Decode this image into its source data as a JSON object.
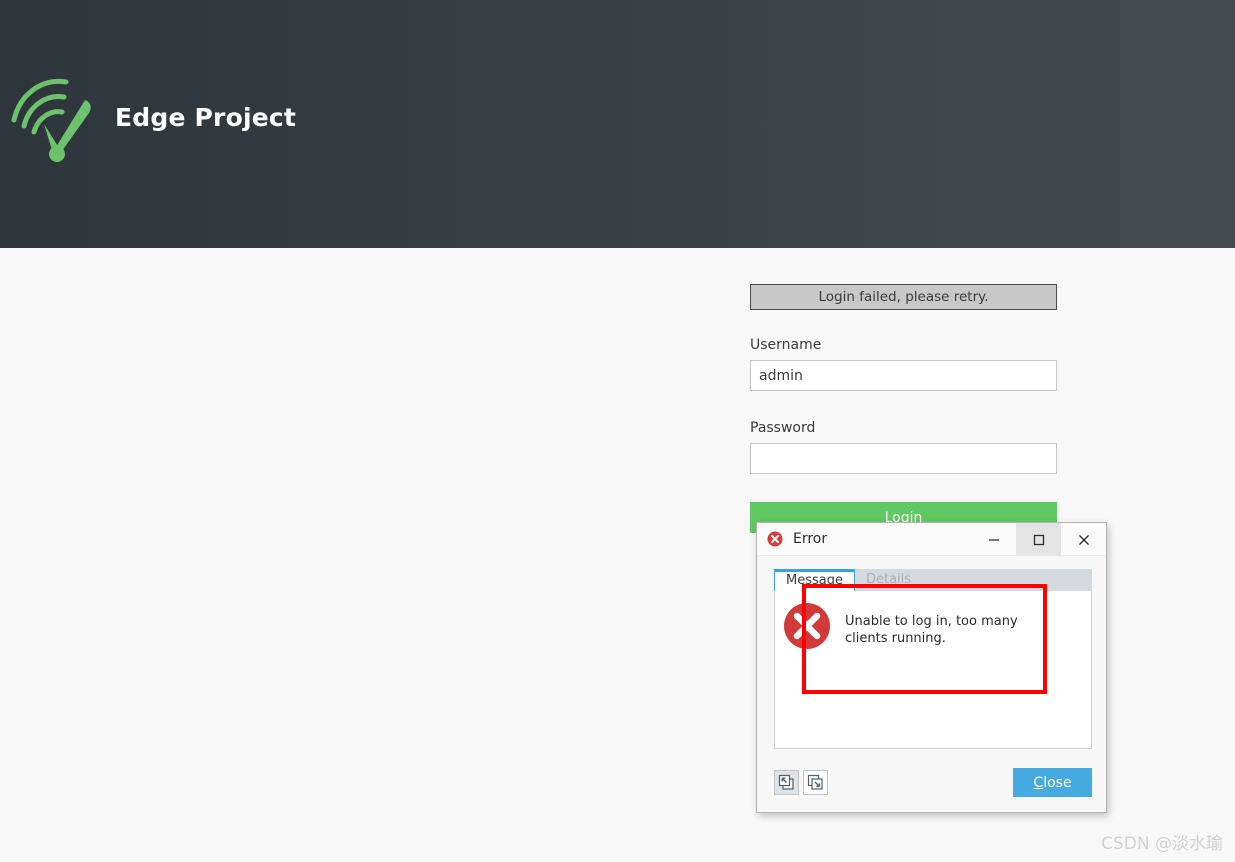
{
  "header": {
    "title": "Edge Project",
    "logo_icon": "wifi-signal-checkmark-logo",
    "logo_color": "#6dc26d",
    "background_color": "#373f45"
  },
  "login": {
    "alert": "Login failed, please retry.",
    "username_label": "Username",
    "username_value": "admin",
    "username_placeholder": "",
    "password_label": "Password",
    "password_value": "",
    "password_placeholder": "",
    "login_button": "Login",
    "login_button_color": "#61c961"
  },
  "dialog": {
    "title": "Error",
    "title_icon": "error-circle-x-icon",
    "minimize_icon": "minimize-icon",
    "maximize_icon": "maximize-icon",
    "close_icon": "close-x-icon",
    "tabs": [
      {
        "label": "Message",
        "active": true,
        "disabled": false
      },
      {
        "label": "Details",
        "active": false,
        "disabled": true
      }
    ],
    "message_icon": "error-circle-x-icon",
    "message": "Unable to log in, too many clients running.",
    "footer": {
      "copy_button_icon": "copy-to-clipboard-icon",
      "copy_all_button_icon": "copy-all-icon",
      "close_label": "Close",
      "close_accesskey": "C",
      "close_rest": "lose",
      "close_color": "#44aae0"
    }
  },
  "annotation": {
    "color": "#ff0000"
  },
  "watermark": "CSDN @淡水瑜"
}
